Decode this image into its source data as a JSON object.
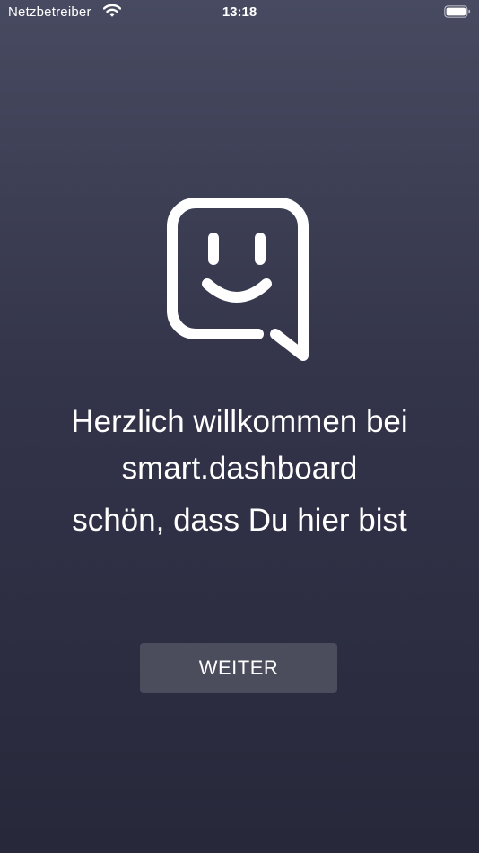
{
  "status_bar": {
    "carrier": "Netzbetreiber",
    "time": "13:18",
    "wifi_icon": "wifi-icon",
    "battery_icon": "battery-icon"
  },
  "logo": {
    "icon": "smiley-chat-bubble-icon"
  },
  "welcome": {
    "line1": "Herzlich willkommen bei",
    "line2": "smart.dashboard",
    "subtitle": "schön, dass Du hier bist"
  },
  "actions": {
    "continue_label": "WEITER"
  },
  "colors": {
    "background_top": "#474a60",
    "background_bottom": "#27283a",
    "button_background": "#4b4c5c",
    "text": "#ffffff"
  }
}
